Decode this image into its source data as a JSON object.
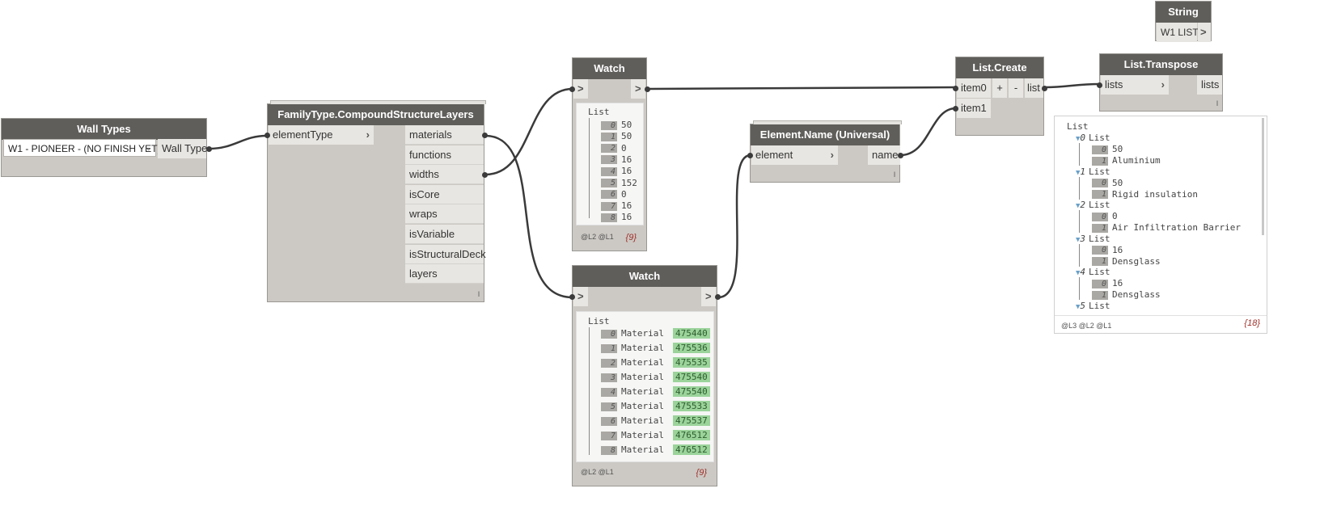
{
  "wall_types": {
    "title": "Wall Types",
    "selected": "W1 - PIONEER - (NO FINISH YET)",
    "output": "Wall Type"
  },
  "family_type": {
    "title": "FamilyType.CompoundStructureLayers",
    "input": "elementType",
    "outputs": [
      "materials",
      "functions",
      "widths",
      "isCore",
      "wraps",
      "isVariable",
      "isStructuralDeck",
      "layers"
    ],
    "footer": "l"
  },
  "watch1": {
    "title": "Watch",
    "in": ">",
    "out": ">",
    "list_label": "List",
    "items": [
      {
        "i": "0",
        "v": "50"
      },
      {
        "i": "1",
        "v": "50"
      },
      {
        "i": "2",
        "v": "0"
      },
      {
        "i": "3",
        "v": "16"
      },
      {
        "i": "4",
        "v": "16"
      },
      {
        "i": "5",
        "v": "152"
      },
      {
        "i": "6",
        "v": "0"
      },
      {
        "i": "7",
        "v": "16"
      },
      {
        "i": "8",
        "v": "16"
      }
    ],
    "levels": "@L2 @L1",
    "count": "{9}"
  },
  "watch2": {
    "title": "Watch",
    "in": ">",
    "out": ">",
    "list_label": "List",
    "items": [
      {
        "i": "0",
        "t": "Material",
        "v": "475440"
      },
      {
        "i": "1",
        "t": "Material",
        "v": "475536"
      },
      {
        "i": "2",
        "t": "Material",
        "v": "475535"
      },
      {
        "i": "3",
        "t": "Material",
        "v": "475540"
      },
      {
        "i": "4",
        "t": "Material",
        "v": "475540"
      },
      {
        "i": "5",
        "t": "Material",
        "v": "475533"
      },
      {
        "i": "6",
        "t": "Material",
        "v": "475537"
      },
      {
        "i": "7",
        "t": "Material",
        "v": "476512"
      },
      {
        "i": "8",
        "t": "Material",
        "v": "476512"
      }
    ],
    "levels": "@L2 @L1",
    "count": "{9}"
  },
  "element_name": {
    "title": "Element.Name (Universal)",
    "input": "element",
    "output": "name",
    "footer": "l"
  },
  "list_create": {
    "title": "List.Create",
    "item0": "item0",
    "item1": "item1",
    "plus": "+",
    "minus": "-",
    "output": "list"
  },
  "list_transpose": {
    "title": "List.Transpose",
    "input": "lists",
    "output": "lists",
    "footer": "l"
  },
  "string_node": {
    "title": "String",
    "value": "W1 LIST",
    "out": ">"
  },
  "transpose_watch": {
    "root": "List",
    "groups": [
      {
        "idx": "0",
        "label": "List",
        "a": "50",
        "b": "Aluminium"
      },
      {
        "idx": "1",
        "label": "List",
        "a": "50",
        "b": "Rigid insulation"
      },
      {
        "idx": "2",
        "label": "List",
        "a": "0",
        "b": "Air Infiltration Barrier"
      },
      {
        "idx": "3",
        "label": "List",
        "a": "16",
        "b": "Densglass"
      },
      {
        "idx": "4",
        "label": "List",
        "a": "16",
        "b": "Densglass"
      },
      {
        "idx": "5",
        "label": "List"
      }
    ],
    "sub0": "0",
    "sub1": "1",
    "levels": "@L3 @L2 @L1",
    "count": "{18}"
  }
}
